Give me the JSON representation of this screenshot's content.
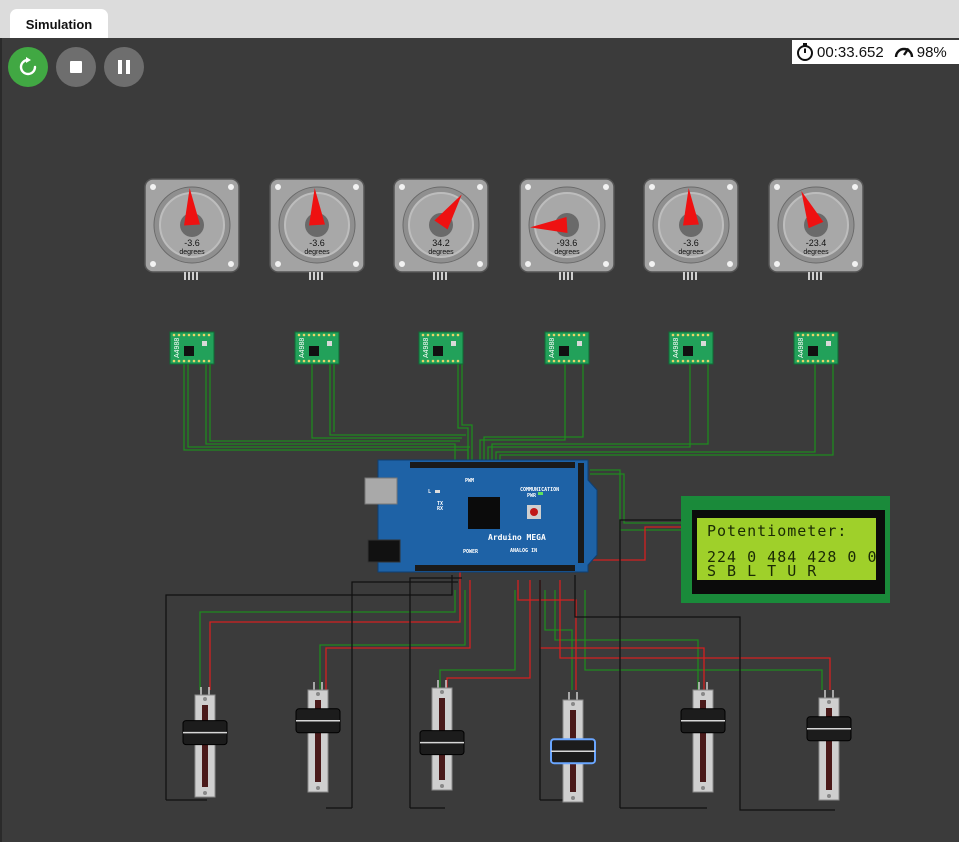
{
  "tab": {
    "label": "Simulation"
  },
  "status": {
    "time": "00:33.652",
    "performance": "98%"
  },
  "motors": [
    {
      "angle_label": "-3.6",
      "unit": "degrees",
      "angle": -3.6
    },
    {
      "angle_label": "-3.6",
      "unit": "degrees",
      "angle": -3.6
    },
    {
      "angle_label": "34.2",
      "unit": "degrees",
      "angle": 34.2
    },
    {
      "angle_label": "-93.6",
      "unit": "degrees",
      "angle": -93.6
    },
    {
      "angle_label": "-3.6",
      "unit": "degrees",
      "angle": -3.6
    },
    {
      "angle_label": "-23.4",
      "unit": "degrees",
      "angle": -23.4
    }
  ],
  "driver_label": "A4988",
  "board": {
    "name": "Arduino MEGA",
    "section_comm": "COMMUNICATION",
    "section_power": "POWER",
    "section_analog": "ANALOG IN",
    "pwm_label": "PWM",
    "tx": "TX",
    "rx": "RX",
    "led": "L",
    "pwr": "PWR"
  },
  "lcd": {
    "line1": "Potentiometer:",
    "line2": "224 0 484 428 0 0",
    "line3": "S B L T U R"
  },
  "sliders": [
    {
      "value_fraction": 0.2
    },
    {
      "value_fraction": 0.1
    },
    {
      "value_fraction": 0.45
    },
    {
      "value_fraction": 0.4
    },
    {
      "value_fraction": 0.1
    },
    {
      "value_fraction": 0.1
    }
  ],
  "icons": {
    "restart": "restart-icon",
    "stop": "stop-icon",
    "pause": "pause-icon",
    "timer": "stopwatch-icon",
    "perf": "speedometer-icon"
  }
}
